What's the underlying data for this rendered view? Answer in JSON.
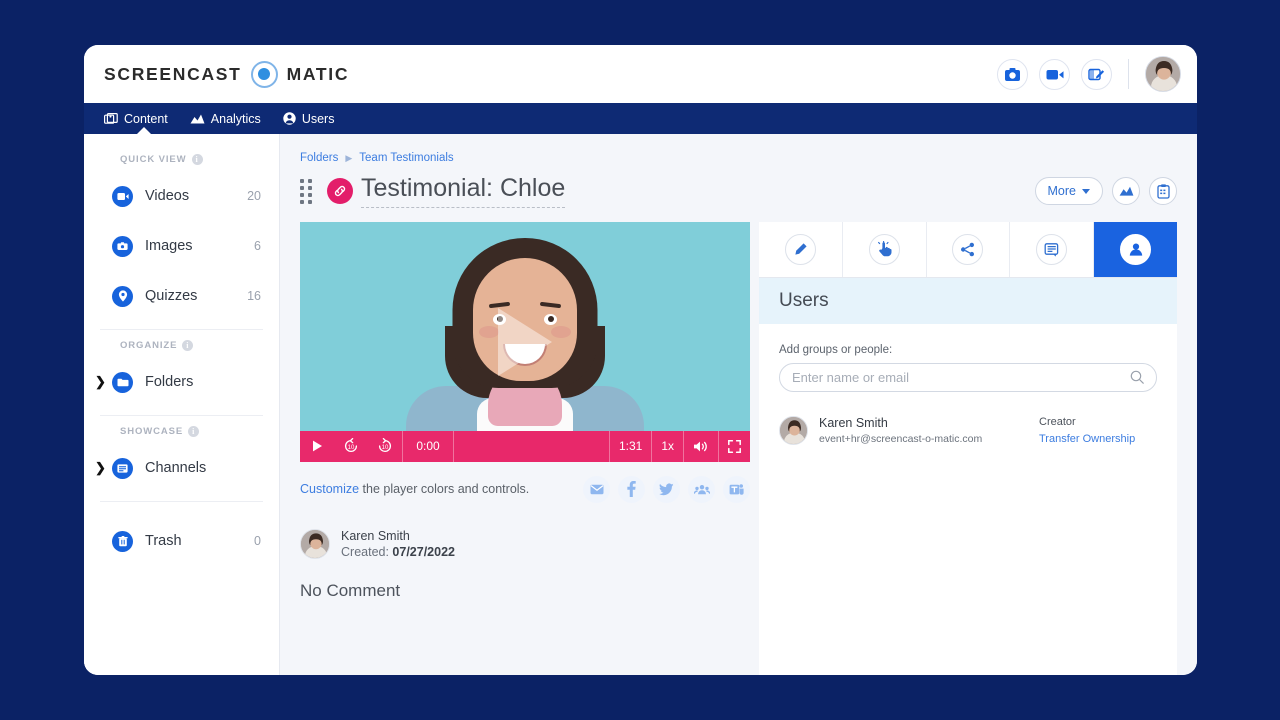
{
  "brand": {
    "word_left": "SCREENCAST",
    "word_right": "MATIC",
    "accent": "#1763dc",
    "navy": "#0e2a74",
    "pink": "#e8296b"
  },
  "header": {
    "actions": [
      {
        "name": "screenshot-icon",
        "label": "Screenshot"
      },
      {
        "name": "record-video-icon",
        "label": "Record Video"
      },
      {
        "name": "edit-video-icon",
        "label": "Edit Video"
      }
    ],
    "avatar_name": "Karen Smith"
  },
  "nav": {
    "items": [
      {
        "id": "content",
        "label": "Content",
        "icon": "images-icon",
        "active": true
      },
      {
        "id": "analytics",
        "label": "Analytics",
        "icon": "chart-icon",
        "active": false
      },
      {
        "id": "users",
        "label": "Users",
        "icon": "person-icon",
        "active": false
      }
    ]
  },
  "sidebar": {
    "sections": [
      {
        "label": "QUICK VIEW",
        "items": [
          {
            "label": "Videos",
            "count": "20",
            "icon": "video-icon",
            "expandable": false
          },
          {
            "label": "Images",
            "count": "6",
            "icon": "image-icon",
            "expandable": false
          },
          {
            "label": "Quizzes",
            "count": "16",
            "icon": "quiz-icon",
            "expandable": false
          }
        ]
      },
      {
        "label": "ORGANIZE",
        "items": [
          {
            "label": "Folders",
            "count": "",
            "icon": "folder-icon",
            "expandable": true
          }
        ]
      },
      {
        "label": "SHOWCASE",
        "items": [
          {
            "label": "Channels",
            "count": "",
            "icon": "channel-icon",
            "expandable": true
          }
        ]
      },
      {
        "label": "",
        "items": [
          {
            "label": "Trash",
            "count": "0",
            "icon": "trash-icon",
            "expandable": false
          }
        ]
      }
    ]
  },
  "main": {
    "breadcrumb": {
      "root": "Folders",
      "current": "Team Testimonials"
    },
    "title": "Testimonial: Chloe",
    "more_label": "More",
    "title_actions": [
      {
        "name": "analytics-icon",
        "label": "Analytics"
      },
      {
        "name": "clipboard-icon",
        "label": "Copy Link"
      }
    ]
  },
  "player": {
    "current_time": "0:00",
    "duration": "1:31",
    "speed": "1x",
    "controls": [
      "play",
      "rewind-10",
      "forward-10",
      "volume",
      "fullscreen"
    ]
  },
  "customize": {
    "link_text": "Customize",
    "rest_text": " the player colors and controls.",
    "socials": [
      {
        "name": "email-icon",
        "label": "Email"
      },
      {
        "name": "facebook-icon",
        "label": "Facebook"
      },
      {
        "name": "twitter-icon",
        "label": "Twitter"
      },
      {
        "name": "google-classroom-icon",
        "label": "Google Classroom"
      },
      {
        "name": "microsoft-teams-icon",
        "label": "Microsoft Teams"
      }
    ]
  },
  "creator": {
    "name": "Karen Smith",
    "created_prefix": "Created: ",
    "created_date": "07/27/2022",
    "comment_status": "No Comment"
  },
  "right_panel": {
    "tabs": [
      {
        "id": "edit",
        "icon": "pencil-icon",
        "label": "Edit",
        "active": false
      },
      {
        "id": "interactive",
        "icon": "click-hand-icon",
        "label": "Interactivity",
        "active": false
      },
      {
        "id": "share",
        "icon": "share-icon",
        "label": "Share",
        "active": false
      },
      {
        "id": "comments",
        "icon": "comment-icon",
        "label": "Comments",
        "active": false
      },
      {
        "id": "users",
        "icon": "person-icon",
        "label": "Users",
        "active": true
      }
    ],
    "heading": "Users",
    "add_label": "Add groups or people:",
    "search_placeholder": "Enter name or email",
    "search_value": "",
    "users": [
      {
        "name": "Karen Smith",
        "email": "event+hr@screencast-o-matic.com",
        "role": "Creator",
        "action": "Transfer Ownership"
      }
    ]
  }
}
